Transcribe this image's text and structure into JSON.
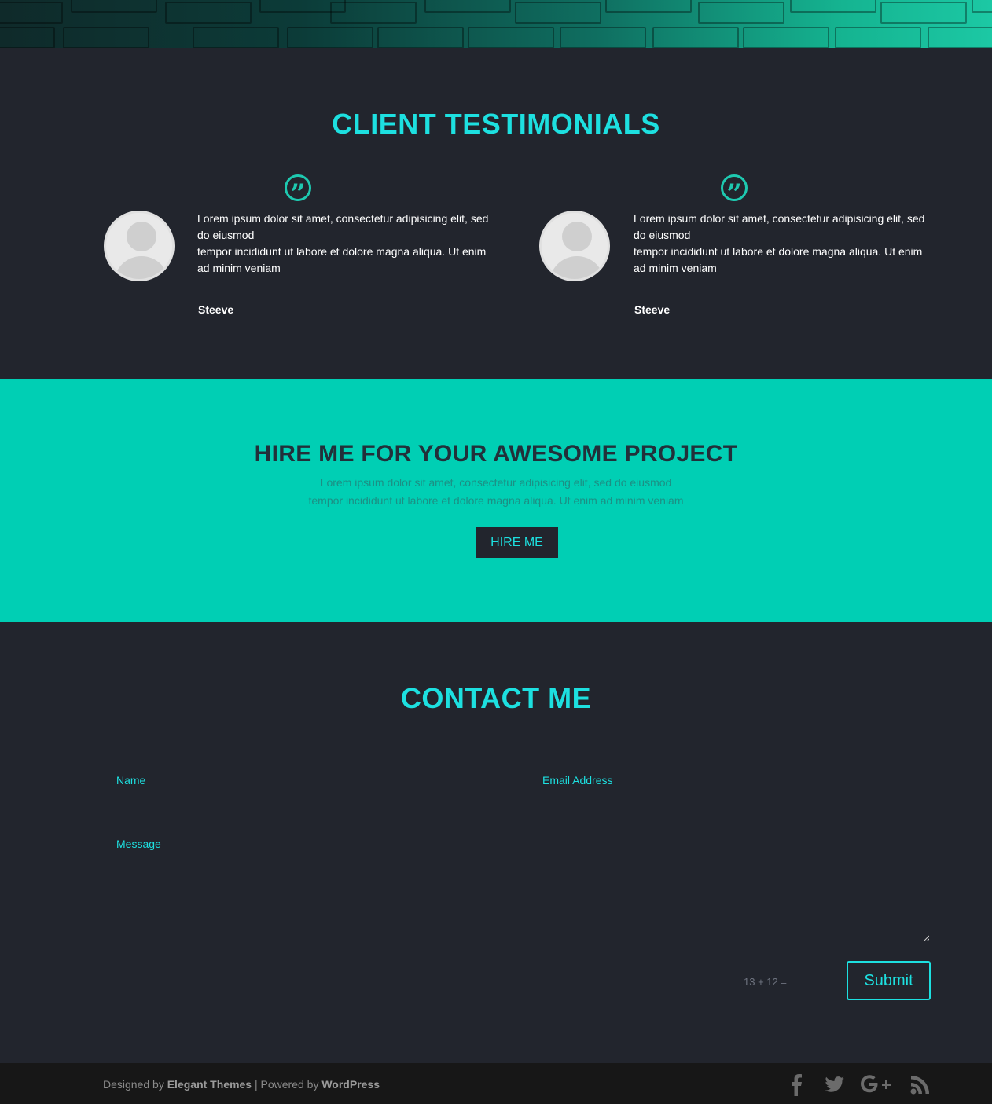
{
  "testimonials": {
    "title": "CLIENT TESTIMONIALS",
    "items": [
      {
        "line1": "Lorem ipsum dolor sit amet, consectetur adipisicing elit, sed",
        "line2": "do eiusmod",
        "line3": "tempor incididunt ut labore et dolore magna aliqua. Ut enim",
        "line4": "ad minim veniam",
        "name": "Steeve"
      },
      {
        "line1": "Lorem ipsum dolor sit amet, consectetur adipisicing elit, sed",
        "line2": "do eiusmod",
        "line3": "tempor incididunt ut labore et dolore magna aliqua. Ut enim",
        "line4": "ad minim veniam",
        "name": "Steeve"
      }
    ]
  },
  "hire": {
    "title": "HIRE ME FOR YOUR AWESOME PROJECT",
    "desc_line1": "Lorem ipsum dolor sit amet, consectetur adipisicing elit, sed do eiusmod",
    "desc_line2": "tempor incididunt ut labore et dolore magna aliqua. Ut enim ad minim veniam",
    "button_label": "HIRE ME"
  },
  "contact": {
    "title": "CONTACT ME",
    "name_label": "Name",
    "email_label": "Email Address",
    "message_label": "Message",
    "captcha_question": "13 + 12 =",
    "submit_label": "Submit"
  },
  "footer": {
    "designed_by_prefix": "Designed by",
    "designed_by_name": "Elegant Themes",
    "separator": "| Powered by",
    "powered_by_name": "WordPress",
    "social_icons": [
      "facebook-icon",
      "twitter-icon",
      "google-plus-icon",
      "rss-icon"
    ]
  },
  "colors": {
    "accent": "#1de0e0",
    "teal_band": "#00cfb4",
    "dark_bg": "#22252d",
    "footer_bg": "#171717"
  }
}
